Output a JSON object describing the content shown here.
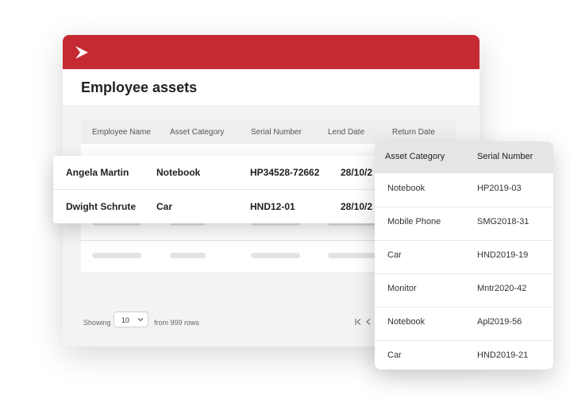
{
  "app": {
    "title": "Employee assets",
    "brand_color": "#c52a33"
  },
  "table": {
    "columns": [
      "Employee Name",
      "Asset Category",
      "Serial Number",
      "Lend Date",
      "Return Date"
    ],
    "rows": [
      {
        "name": "Angela Martin",
        "category": "Notebook",
        "serial": "HP34528-72662",
        "lend": "28/10/2"
      },
      {
        "name": "Dwight Schrute",
        "category": "Car",
        "serial": "HND12-01",
        "lend": "28/10/2"
      }
    ]
  },
  "footer": {
    "showing": "Showing",
    "page_size": "10",
    "from": "from 999 rows",
    "first_icon": "first-page-icon",
    "prev_icon": "prev-page-icon"
  },
  "asset_card": {
    "columns": [
      "Asset Category",
      "Serial Number"
    ],
    "rows": [
      {
        "category": "Notebook",
        "serial": "HP2019-03"
      },
      {
        "category": "Mobile Phone",
        "serial": "SMG2018-31"
      },
      {
        "category": "Car",
        "serial": "HND2019-19"
      },
      {
        "category": "Monitor",
        "serial": "Mntr2020-42"
      },
      {
        "category": "Notebook",
        "serial": "Apl2019-56"
      },
      {
        "category": "Car",
        "serial": "HND2019-21"
      }
    ]
  }
}
